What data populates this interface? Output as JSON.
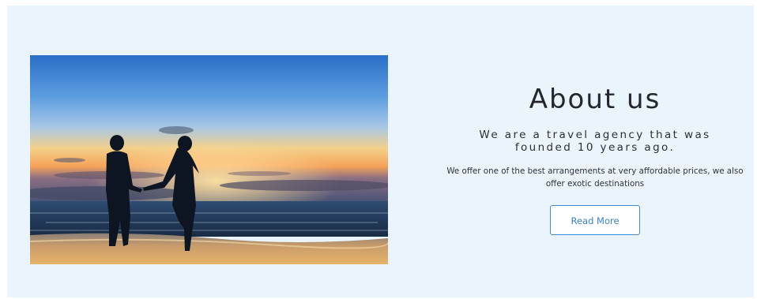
{
  "about": {
    "title": "About us",
    "subtitle": "We are a travel agency that was founded 10 years ago.",
    "description": "We offer one of the best arrangements at very affordable prices, we also offer exotic destinations",
    "button_label": "Read More"
  },
  "image": {
    "subject": "beach-sunset-couple-photo"
  },
  "colors": {
    "section_background": "#eaf4fd",
    "button_border": "#3f8bd6",
    "button_text": "#3a7fcc",
    "heading_text": "#22262d"
  }
}
